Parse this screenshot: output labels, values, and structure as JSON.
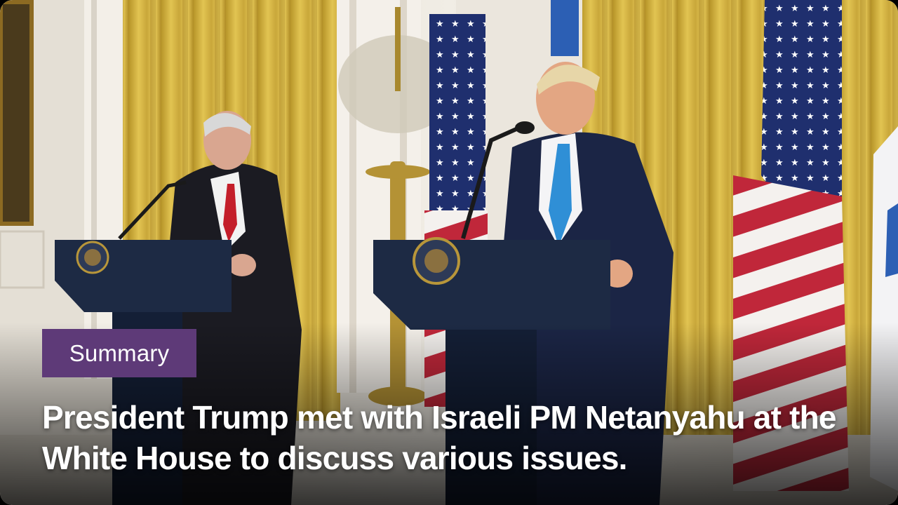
{
  "card": {
    "tag_label": "Summary",
    "headline": "President Trump met with Israeli PM Netanyahu at the White House to discuss various issues."
  },
  "colors": {
    "tag_background": "#5e3a78",
    "curtain_gold": "#d4b23a",
    "wall_white": "#ece8e0",
    "podium_navy": "#1d2a44",
    "tie_red": "#c41e2a",
    "tie_blue": "#2f8fd6"
  }
}
